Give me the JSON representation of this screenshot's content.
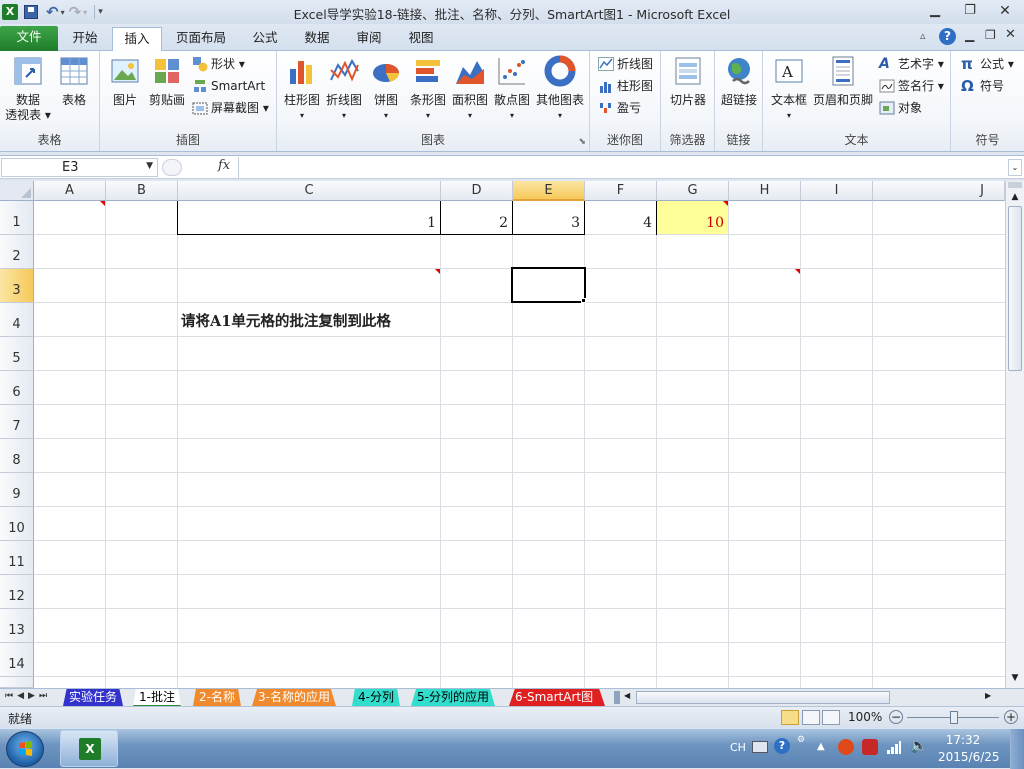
{
  "window": {
    "title": "Excel导学实验18-链接、批注、名称、分列、SmartArt图1  -  Microsoft Excel"
  },
  "tabs": [
    "文件",
    "开始",
    "插入",
    "页面布局",
    "公式",
    "数据",
    "审阅",
    "视图"
  ],
  "active_tab": "插入",
  "ribbon": {
    "groups": {
      "tables": "表格",
      "illustrations": "插图",
      "charts": "图表",
      "sparklines": "迷你图",
      "filter": "筛选器",
      "links": "链接",
      "text": "文本",
      "symbols": "符号"
    },
    "pivot_line1": "数据",
    "pivot_line2": "透视表",
    "table": "表格",
    "picture": "图片",
    "clipart": "剪贴画",
    "shapes": "形状",
    "smartart": "SmartArt",
    "screenshot": "屏幕截图",
    "column": "柱形图",
    "line": "折线图",
    "pie": "饼图",
    "bar": "条形图",
    "area": "面积图",
    "scatter": "散点图",
    "other": "其他图表",
    "sp_line": "折线图",
    "sp_column": "柱形图",
    "sp_winloss": "盈亏",
    "slicer": "切片器",
    "hyperlink": "超链接",
    "textbox": "文本框",
    "headerfooter": "页眉和页脚",
    "wordart": "艺术字",
    "signature": "签名行",
    "object": "对象",
    "equation": "公式",
    "symbol": "符号"
  },
  "formula_bar": {
    "name_box": "E3",
    "fx": "fx",
    "content": ""
  },
  "columns": [
    "A",
    "B",
    "C",
    "D",
    "E",
    "F",
    "G",
    "H",
    "I",
    "J"
  ],
  "rows": [
    "1",
    "2",
    "3",
    "4",
    "5",
    "6",
    "7",
    "8",
    "9",
    "10",
    "11",
    "12",
    "13",
    "14"
  ],
  "cells": {
    "C1": "1",
    "D1": "2",
    "E1": "3",
    "F1": "4",
    "G1": "10",
    "C4": "请将A1单元格的批注复制到此格"
  },
  "selected_cell": "E3",
  "sheet_tabs": [
    "实验任务",
    "1-批注",
    "2-名称",
    "3-名称的应用",
    "4-分列",
    "5-分列的应用",
    "6-SmartArt图"
  ],
  "active_sheet": "1-批注",
  "sheet_tab_colors": {
    "实验任务": "#3333cc",
    "1-批注": "#ffffff",
    "2-名称": "#f08a2c",
    "3-名称的应用": "#f08a2c",
    "4-分列": "#33ddcc",
    "5-分列的应用": "#33ddcc",
    "6-SmartArt图": "#e02020"
  },
  "status": {
    "ready": "就绪",
    "zoom": "100%"
  },
  "taskbar": {
    "lang": "CH",
    "time": "17:32",
    "date": "2015/6/25"
  },
  "colors": {
    "accent_green": "#2a8a34",
    "highlight_yellow": "#ffff99",
    "red_text": "#cc0000"
  }
}
